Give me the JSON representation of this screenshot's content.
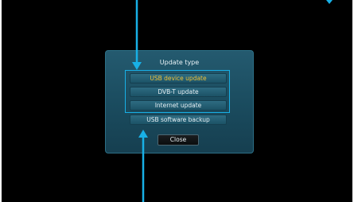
{
  "dialog": {
    "title": "Update type",
    "options": [
      {
        "label": "USB device update",
        "selected": true
      },
      {
        "label": "DVB-T update",
        "selected": false
      },
      {
        "label": "Internet update",
        "selected": false
      },
      {
        "label": "USB software backup",
        "selected": false
      }
    ],
    "close_label": "Close"
  },
  "colors": {
    "background": "#000000",
    "dialog_fill": "#1d5266",
    "selected_text": "#f0c23a",
    "highlight_frame": "#18b0e6",
    "pointer_arrow": "#18b0e6"
  }
}
